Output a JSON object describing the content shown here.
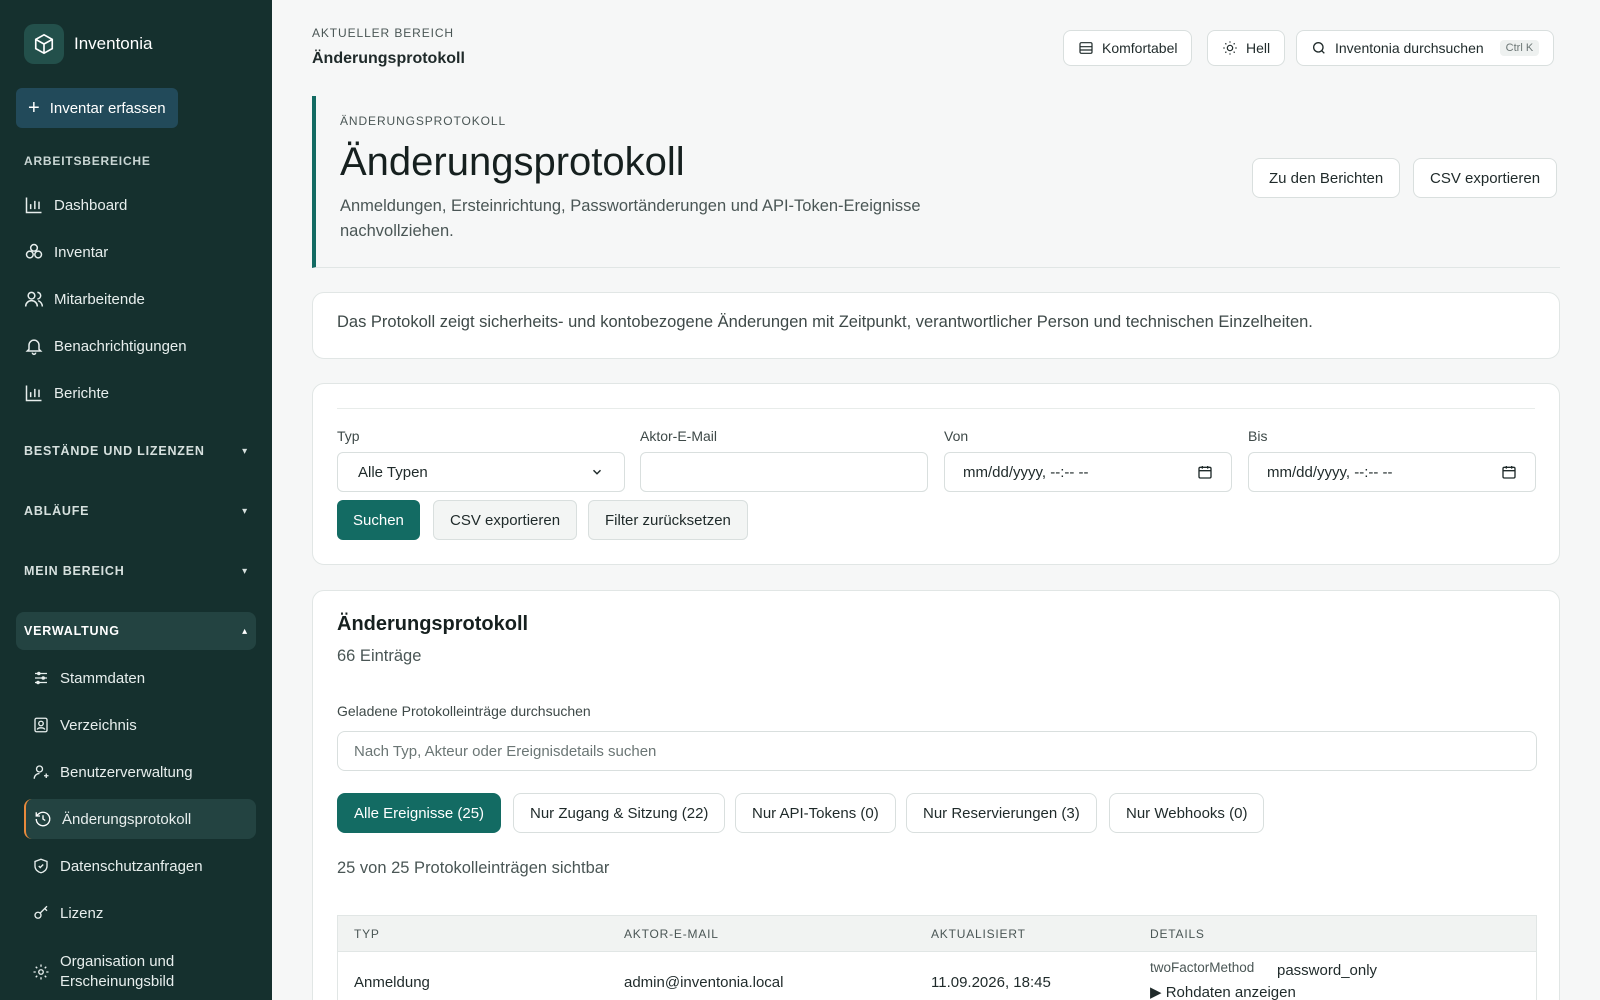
{
  "brand": {
    "name": "Inventonia"
  },
  "sidebar": {
    "add_button": "Inventar erfassen",
    "section_label": "ARBEITSBEREICHE",
    "items": [
      {
        "label": "Dashboard",
        "icon": "bar-chart-icon"
      },
      {
        "label": "Inventar",
        "icon": "cubes-icon"
      },
      {
        "label": "Mitarbeitende",
        "icon": "users-icon"
      },
      {
        "label": "Benachrichtigungen",
        "icon": "bell-icon"
      },
      {
        "label": "Berichte",
        "icon": "bar-chart-icon"
      }
    ],
    "groups": [
      {
        "label": "BESTÄNDE UND LIZENZEN",
        "state": "collapsed",
        "indicator": "▾"
      },
      {
        "label": "ABLÄUFE",
        "state": "collapsed",
        "indicator": "▾"
      },
      {
        "label": "MEIN BEREICH",
        "state": "collapsed",
        "indicator": "▾"
      },
      {
        "label": "VERWALTUNG",
        "state": "expanded",
        "indicator": "▴"
      }
    ],
    "admin_items": [
      {
        "label": "Stammdaten",
        "icon": "sliders-icon"
      },
      {
        "label": "Verzeichnis",
        "icon": "contact-card-icon"
      },
      {
        "label": "Benutzerverwaltung",
        "icon": "user-settings-icon"
      },
      {
        "label": "Änderungsprotokoll",
        "icon": "history-icon",
        "active": true
      },
      {
        "label": "Datenschutzanfragen",
        "icon": "shield-check-icon"
      },
      {
        "label": "Lizenz",
        "icon": "key-icon"
      },
      {
        "label": "Organisation und Erscheinungsbild",
        "icon": "gear-icon"
      }
    ]
  },
  "header": {
    "breadcrumb_label": "AKTUELLER BEREICH",
    "breadcrumb_title": "Änderungsprotokoll",
    "density_button": "Komfortabel",
    "theme_button": "Hell",
    "search_button": "Inventonia durchsuchen",
    "search_shortcut": "Ctrl K"
  },
  "page": {
    "overline": "ÄNDERUNGSPROTOKOLL",
    "title": "Änderungsprotokoll",
    "subtitle": "Anmeldungen, Ersteinrichtung, Passwortänderungen und API-Token-Ereignisse nachvollziehen.",
    "reports_button": "Zu den Berichten",
    "export_button": "CSV exportieren",
    "info": "Das Protokoll zeigt sicherheits- und kontobezogene Änderungen mit Zeitpunkt, verantwortlicher Person und technischen Einzelheiten."
  },
  "filters": {
    "type_label": "Typ",
    "type_value": "Alle Typen",
    "actor_label": "Aktor-E-Mail",
    "actor_value": "",
    "from_label": "Von",
    "from_value": "mm/dd/yyyy, --:-- --",
    "to_label": "Bis",
    "to_value": "mm/dd/yyyy, --:-- --",
    "search_button": "Suchen",
    "export_button": "CSV exportieren",
    "reset_button": "Filter zurücksetzen"
  },
  "log": {
    "title": "Änderungsprotokoll",
    "count": "66 Einträge",
    "search_label": "Geladene Protokolleinträge durchsuchen",
    "search_placeholder": "Nach Typ, Akteur oder Ereignisdetails suchen",
    "chips": [
      {
        "label": "Alle Ereignisse (25)",
        "active": true
      },
      {
        "label": "Nur Zugang & Sitzung (22)",
        "active": false
      },
      {
        "label": "Nur API-Tokens (0)",
        "active": false
      },
      {
        "label": "Nur Reservierungen (3)",
        "active": false
      },
      {
        "label": "Nur Webhooks (0)",
        "active": false
      }
    ],
    "visible_count": "25 von 25 Protokolleinträgen sichtbar",
    "columns": [
      "TYP",
      "AKTOR-E-MAIL",
      "AKTUALISIERT",
      "DETAILS"
    ],
    "rows": [
      {
        "type": "Anmeldung",
        "actor": "admin@inventonia.local",
        "updated": "11.09.2026, 18:45",
        "detail_key": "twoFactorMethod",
        "detail_value": "password_only",
        "raw_toggle": "▶ Rohdaten anzeigen"
      }
    ]
  },
  "colors": {
    "sidebar_bg": "#15302e",
    "accent": "#136b63",
    "active_indicator": "#e88a3c"
  }
}
